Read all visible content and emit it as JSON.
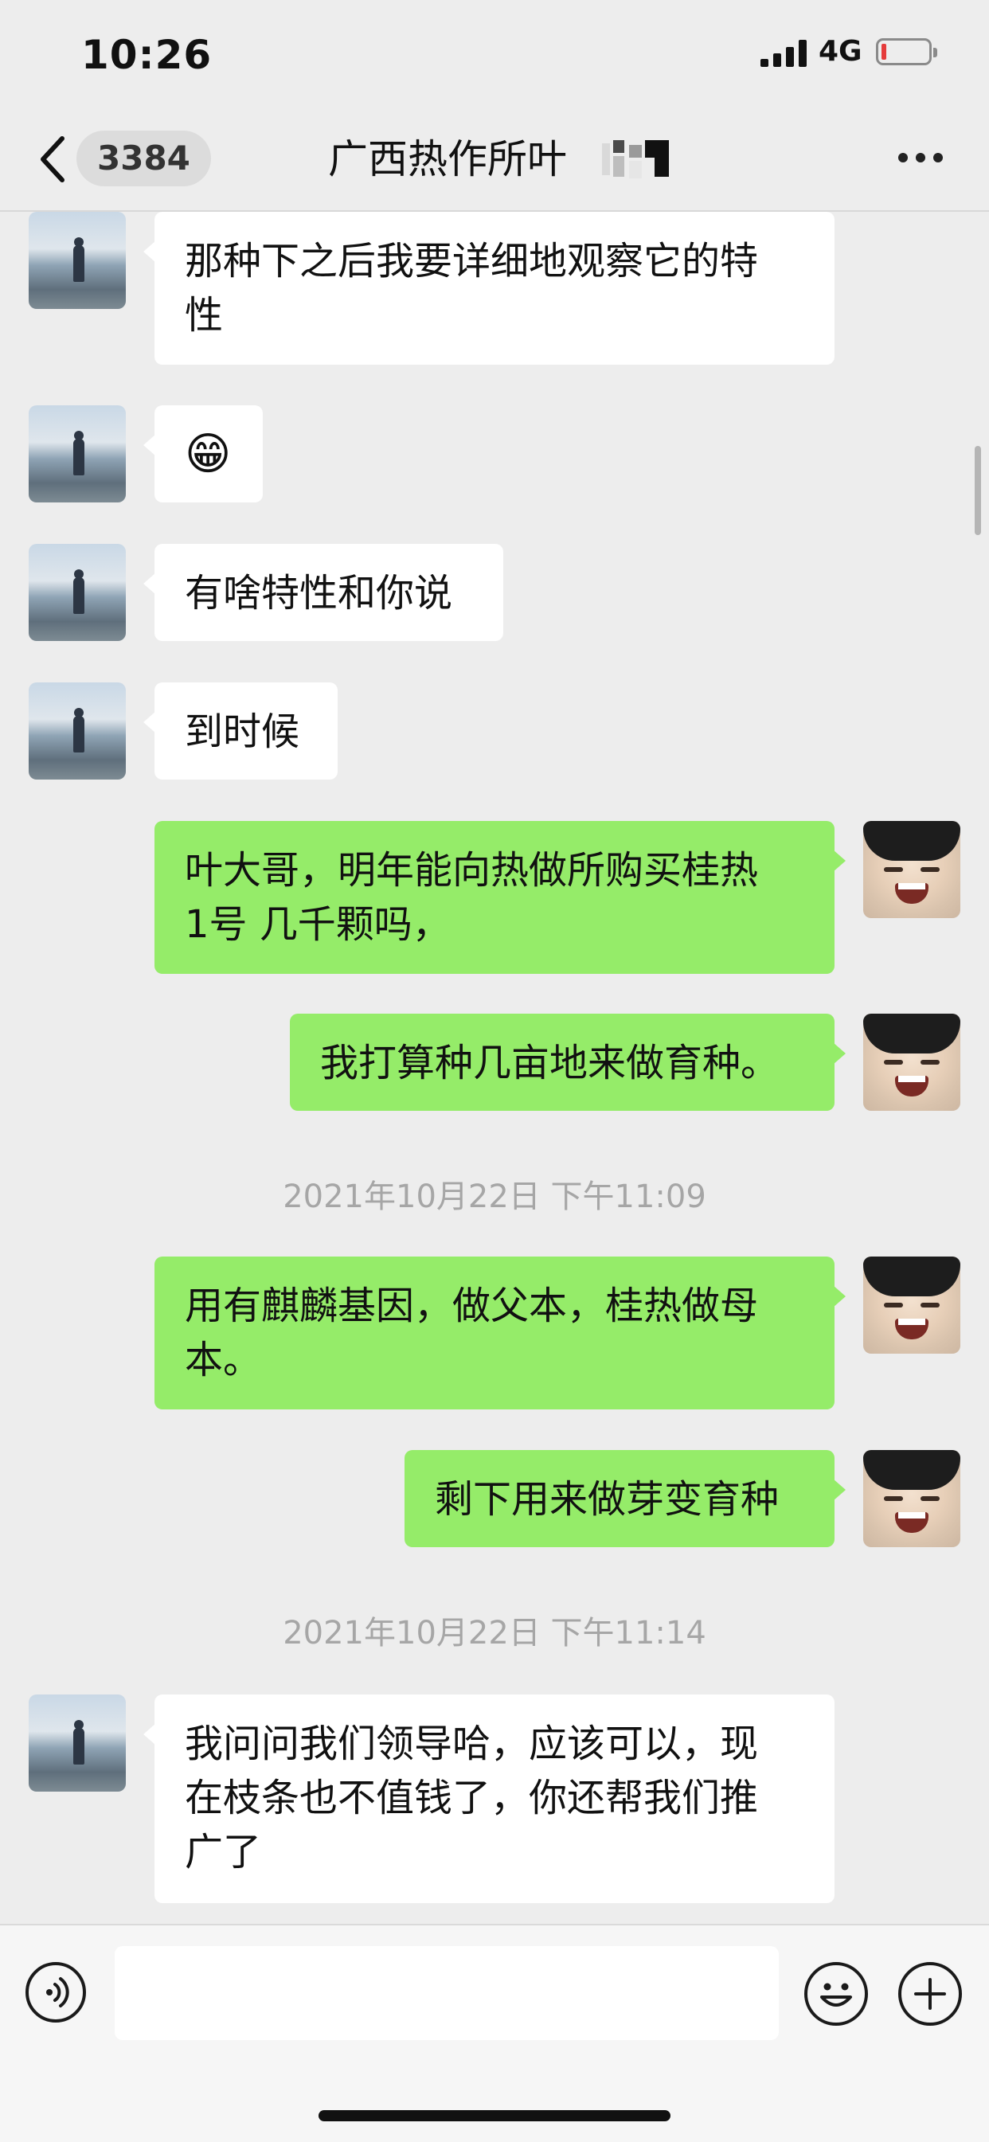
{
  "status_bar": {
    "time": "10:26",
    "network": "4G",
    "battery_color": "#e53b3b"
  },
  "header": {
    "unread_count": "3384",
    "title": "广西热作所叶"
  },
  "messages": [
    {
      "side": "in",
      "lines": [
        "那种下之后我要详细地观察它的特",
        "性"
      ]
    },
    {
      "side": "in",
      "emoji": "😁"
    },
    {
      "side": "in",
      "lines": [
        "有啥特性和你说"
      ]
    },
    {
      "side": "in",
      "lines": [
        "到时候"
      ]
    },
    {
      "side": "out",
      "lines": [
        "叶大哥，明年能向热做所购买桂热",
        "1号 几千颗吗，"
      ]
    },
    {
      "side": "out",
      "lines": [
        "我打算种几亩地来做育种。"
      ]
    },
    {
      "timestamp": "2021年10月22日 下午11:09"
    },
    {
      "side": "out",
      "lines": [
        "用有麒麟基因，做父本，桂热做母",
        "本。"
      ]
    },
    {
      "side": "out",
      "lines": [
        "剩下用来做芽变育种"
      ]
    },
    {
      "timestamp": "2021年10月22日 下午11:14"
    },
    {
      "side": "in",
      "lines": [
        "我问问我们领导哈，应该可以，现",
        "在枝条也不值钱了，你还帮我们推",
        "广了"
      ]
    }
  ],
  "colors": {
    "incoming_bubble": "#ffffff",
    "outgoing_bubble": "#95ec69",
    "background": "#ededed"
  },
  "icons": {
    "back": "chevron-left-icon",
    "more": "more-dots-icon",
    "voice": "voice-icon",
    "emoji": "emoji-icon",
    "add": "plus-icon"
  }
}
